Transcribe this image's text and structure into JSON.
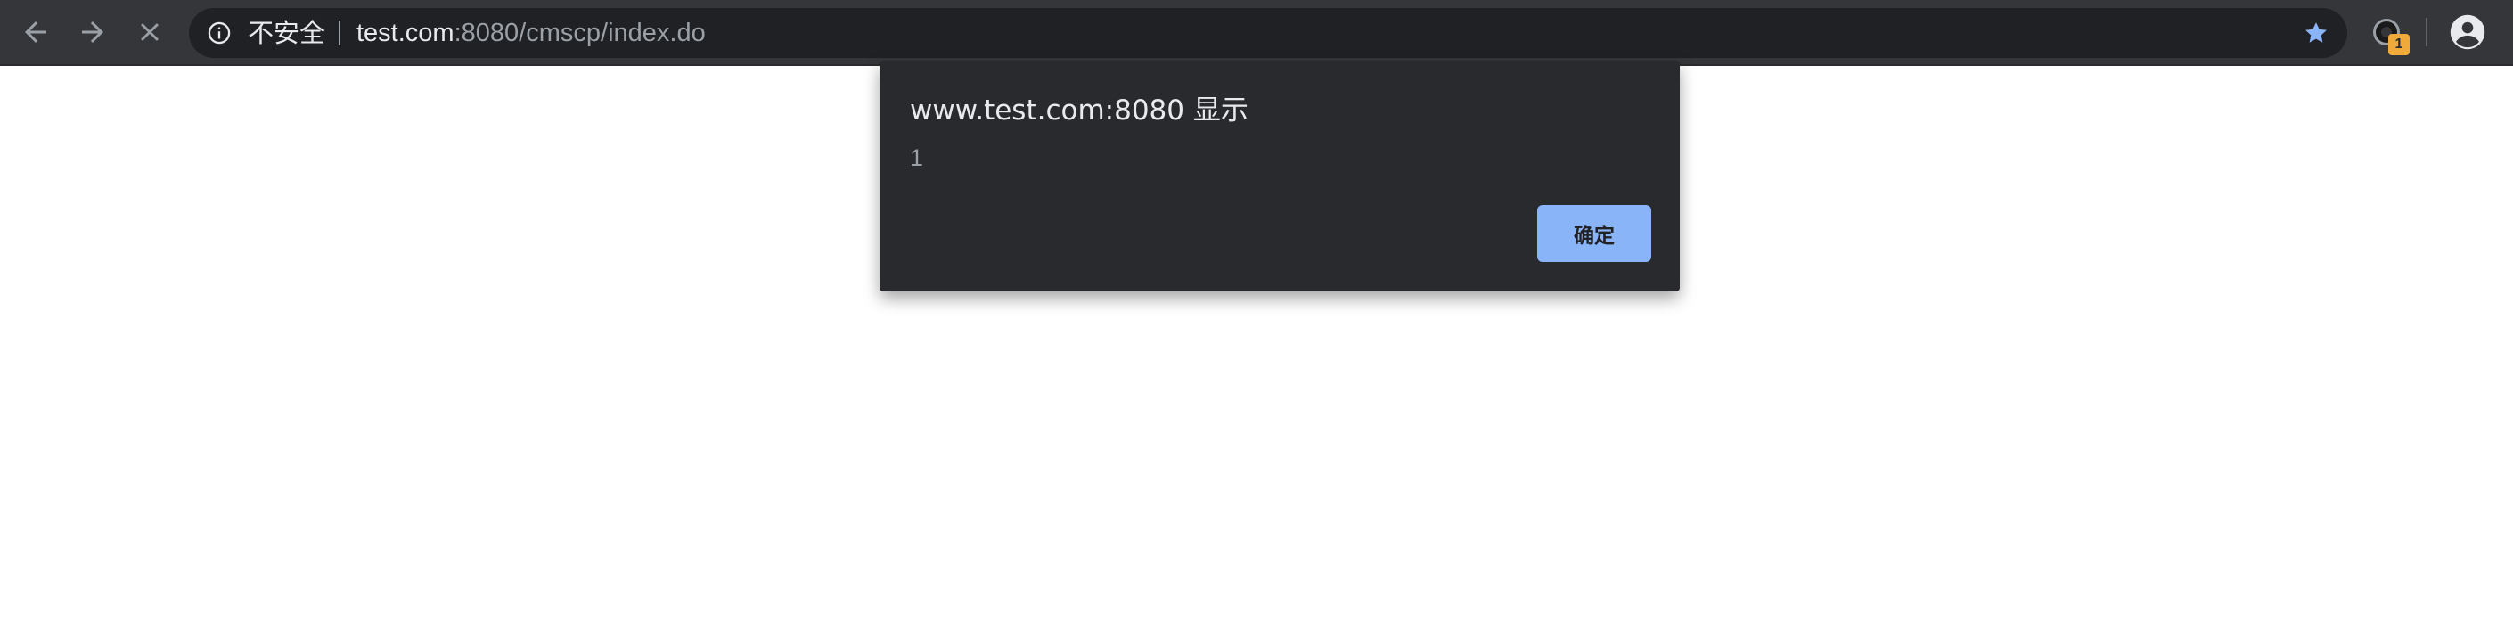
{
  "browser": {
    "nav": {
      "back_icon": "back-arrow-icon",
      "forward_icon": "forward-arrow-icon",
      "stop_icon": "stop-loading-icon"
    },
    "omnibox": {
      "security_label": "不安全",
      "url_host": "test.com",
      "url_rest": ":8080/cmscp/index.do",
      "info_icon": "info-icon",
      "bookmark_icon": "star-icon"
    },
    "extension": {
      "icon": "extension-icon",
      "badge": "1"
    },
    "profile_icon": "profile-icon"
  },
  "dialog": {
    "title": "www.test.com:8080 显示",
    "message": "1",
    "ok_label": "确定"
  },
  "colors": {
    "toolbar": "#35363a",
    "omnibox": "#202124",
    "dialog": "#292a2d",
    "ok_button": "#8ab4f8",
    "star": "#8ab4f8",
    "badge": "#f0a93b"
  }
}
